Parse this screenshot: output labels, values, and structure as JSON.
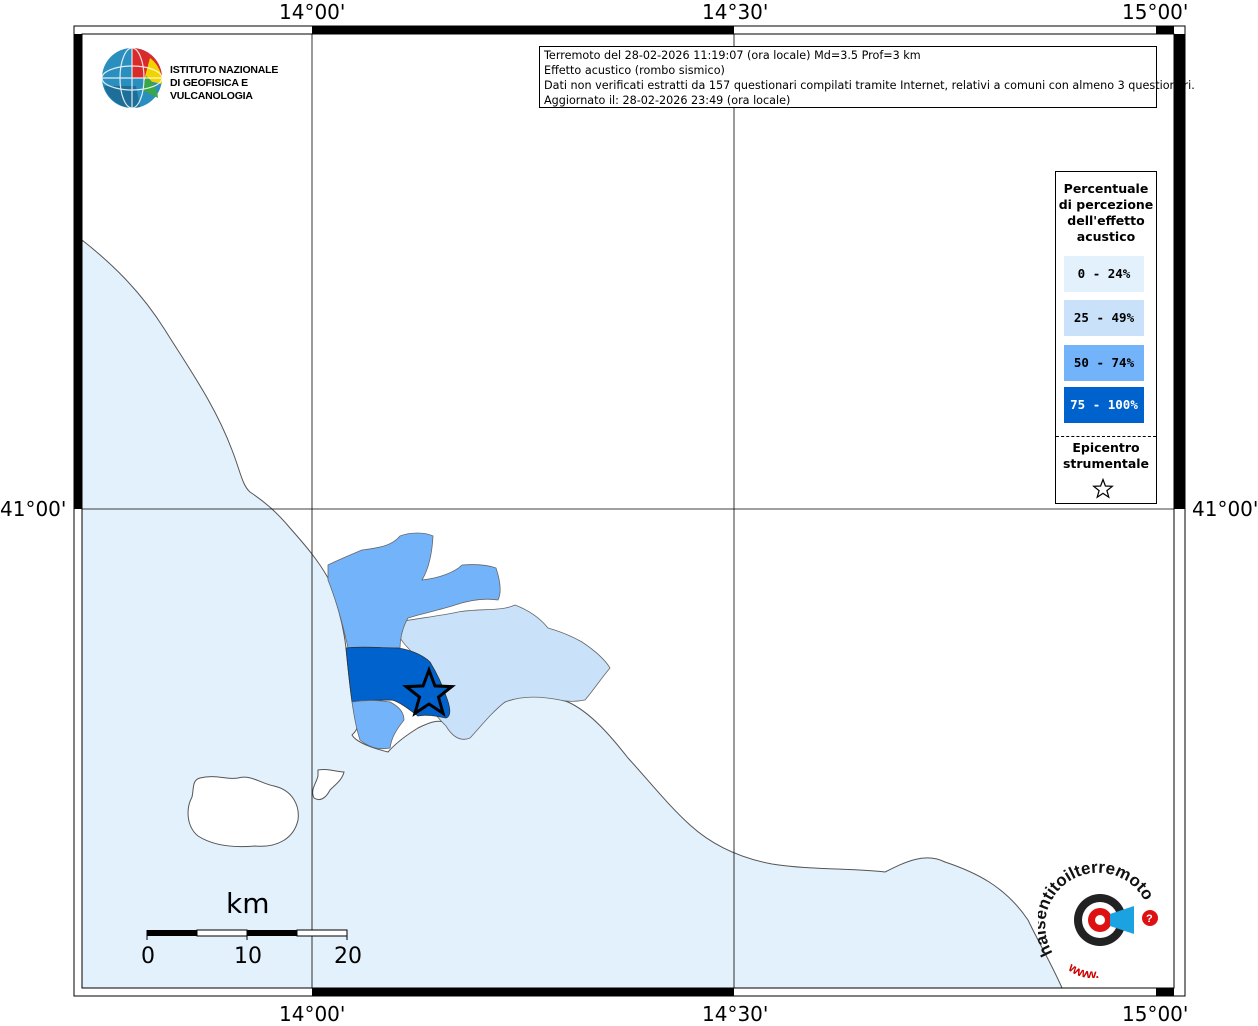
{
  "axes": {
    "top": [
      "14°00'",
      "14°30'",
      "15°00'"
    ],
    "bottom": [
      "14°00'",
      "14°30'",
      "15°00'"
    ],
    "left": [
      "41°00'"
    ],
    "right": [
      "41°00'"
    ]
  },
  "logo": {
    "line1": "ISTITUTO NAZIONALE",
    "line2": "DI GEOFISICA E VULCANOLOGIA"
  },
  "info": {
    "line1": "Terremoto del 28-02-2026 11:19:07 (ora locale) Md=3.5 Prof=3 km",
    "line2": "Effetto acustico (rombo sismico)",
    "line3": "Dati non verificati estratti da 157 questionari compilati tramite Internet, relativi a comuni con almeno 3 questionari.",
    "line4": "Aggiornato il: 28-02-2026 23:49 (ora locale)"
  },
  "legend": {
    "title_l1": "Percentuale",
    "title_l2": "di percezione",
    "title_l3": "dell'effetto",
    "title_l4": "acustico",
    "classes": [
      {
        "label": "0 - 24%",
        "color": "#e3f1fc"
      },
      {
        "label": "25 - 49%",
        "color": "#c9e2fa"
      },
      {
        "label": "50 - 74%",
        "color": "#73b3f9"
      },
      {
        "label": "75 - 100%",
        "color": "#0062cc"
      }
    ],
    "epi_l1": "Epicentro",
    "epi_l2": "strumentale"
  },
  "scalebar": {
    "unit": "km",
    "ticks": [
      "0",
      "10",
      "20"
    ]
  },
  "colors": {
    "sea": "#e3f1fc",
    "land": "#ffffff",
    "frame": "#000000"
  },
  "hai_logo": {
    "text": "haisentitoilterremoto.it",
    "url": "www."
  }
}
